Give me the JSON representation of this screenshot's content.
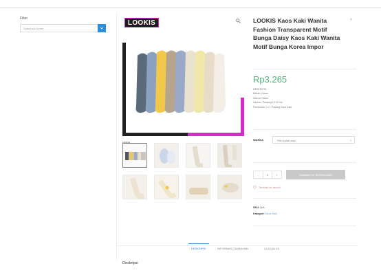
{
  "sidebar": {
    "title": "Filter",
    "select_placeholder": "Select sort order",
    "select_button_icon": "chevron-down-icon"
  },
  "product": {
    "brand_logo_text": "LOOKIS",
    "thumbnail_label": "LOOKIS",
    "title": "LOOKIS Kaos Kaki Wanita Fashion Transparent Motif Bunga Daisy Kaos Kaki Wanita Motif Bunga Korea Impor",
    "price": "Rp3.265",
    "description_lines": [
      "DESKRIPSI:",
      "Bahan: Katun",
      "Warna: Hitam",
      "Ukuran: Panjang 10-12 cm",
      "Pembelian 1 x 1 Pasang Kaos Kaki"
    ],
    "variant_label": "WARNA",
    "variant_placeholder": "Pilih salah satu",
    "quantity": "1",
    "qty_minus": "-",
    "qty_plus": "+",
    "add_to_cart_label": "TAMBAH KE KERANJANG",
    "compare_label": "Tambah ke favorit",
    "sku_label": "SKU:",
    "sku_value": "N/A",
    "category_label": "Kategori:",
    "category_value": "Kaos Kaki"
  },
  "tabs": [
    {
      "label": "DESKRIPSI",
      "active": true
    },
    {
      "label": "INFORMASI TAMBAHAN",
      "active": false
    },
    {
      "label": "ULASAN (0)",
      "active": false
    }
  ],
  "description_heading": "Deskripsi",
  "colors": {
    "accent_blue": "#2b8fe0",
    "price_green": "#49b675",
    "brand_magenta": "#d62ad0"
  },
  "thumbnails": [
    {
      "name": "thumb-socks-set"
    },
    {
      "name": "thumb-socks-blue"
    },
    {
      "name": "thumb-socks-foot"
    },
    {
      "name": "thumb-socks-feet"
    },
    {
      "name": "thumb-socks-flower"
    },
    {
      "name": "thumb-socks-daisy"
    },
    {
      "name": "thumb-socks-beige"
    },
    {
      "name": "thumb-socks-pair"
    }
  ]
}
